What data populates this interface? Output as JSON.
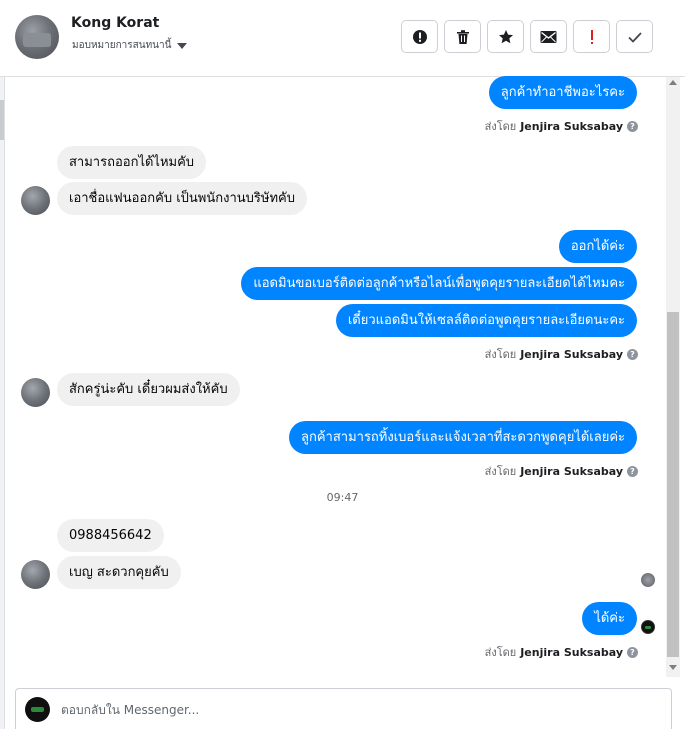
{
  "contact": {
    "name": "Kong Korat",
    "assign_label": "มอบหมายการสนทนานี้"
  },
  "toolbar": {
    "buttons": [
      {
        "id": "alert",
        "icon": "exclamation-circle-icon"
      },
      {
        "id": "delete",
        "icon": "trash-icon"
      },
      {
        "id": "star",
        "icon": "star-icon"
      },
      {
        "id": "mail",
        "icon": "envelope-icon"
      },
      {
        "id": "spam",
        "icon": "red-exclamation-icon"
      },
      {
        "id": "done",
        "icon": "checkmark-icon"
      }
    ]
  },
  "messages": {
    "m1": "ลูกค้าทำอาชีพอะไรคะ",
    "m2": "สามารถออกได้ไหมคับ",
    "m3": "เอาชื่อแฟนออกคับ เป็นพนักงานบริษัทคับ",
    "m4": "ออกได้ค่ะ",
    "m5": "แอดมินขอเบอร์ติดต่อลูกค้าหรือไลน์เพื่อพูดคุยรายละเอียดได้ไหมคะ",
    "m6": "เดี๋ยวแอดมินให้เซลล์ติดต่อพูดคุยรายละเอียดนะคะ",
    "m7": "สักครู่น่ะคับ เดี๋ยวผมส่งให้คับ",
    "m8": "ลูกค้าสามารถทิ้งเบอร์และแจ้งเวลาที่สะดวกพูดคุยได้เลยค่ะ",
    "m9": "0988456642",
    "m10": "เบญ สะดวกคุยคับ",
    "m11": "ได้ค่ะ"
  },
  "sent_by": {
    "prefix": "ส่งโดย",
    "name": "Jenjira Suksabay",
    "help": "?"
  },
  "timestamp": "09:47",
  "composer": {
    "placeholder": "ตอบกลับใน Messenger..."
  },
  "colors": {
    "outgoing": "#0084ff",
    "incoming": "#f0f0f0",
    "accent_red": "#e02020"
  }
}
